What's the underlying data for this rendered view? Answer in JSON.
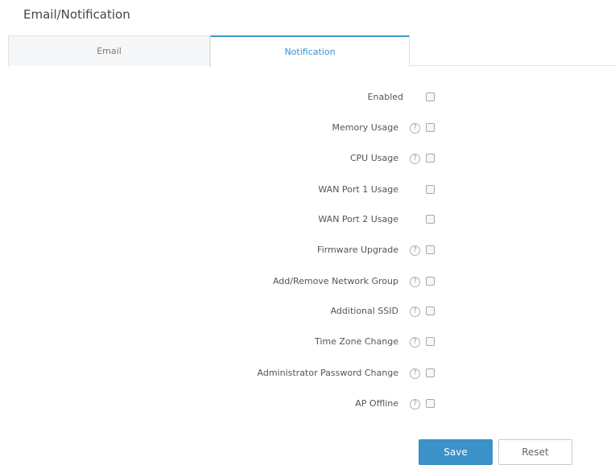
{
  "page": {
    "title": "Email/Notification"
  },
  "tabs": [
    {
      "label": "Email",
      "active": false
    },
    {
      "label": "Notification",
      "active": true
    }
  ],
  "form": {
    "rows": [
      {
        "label": "Enabled",
        "help": false,
        "checked": false
      },
      {
        "label": "Memory Usage",
        "help": true,
        "checked": false
      },
      {
        "label": "CPU Usage",
        "help": true,
        "checked": false
      },
      {
        "label": "WAN Port 1 Usage",
        "help": false,
        "checked": false
      },
      {
        "label": "WAN Port 2 Usage",
        "help": false,
        "checked": false
      },
      {
        "label": "Firmware Upgrade",
        "help": true,
        "checked": false
      },
      {
        "label": "Add/Remove Network Group",
        "help": true,
        "checked": false
      },
      {
        "label": "Additional SSID",
        "help": true,
        "checked": false
      },
      {
        "label": "Time Zone Change",
        "help": true,
        "checked": false
      },
      {
        "label": "Administrator Password Change",
        "help": true,
        "checked": false
      },
      {
        "label": "AP Offline",
        "help": true,
        "checked": false
      }
    ],
    "help_glyph": "?"
  },
  "actions": {
    "save_label": "Save",
    "reset_label": "Reset"
  },
  "colors": {
    "accent": "#3a92c8",
    "tab_active_text": "#3a8fc4"
  }
}
